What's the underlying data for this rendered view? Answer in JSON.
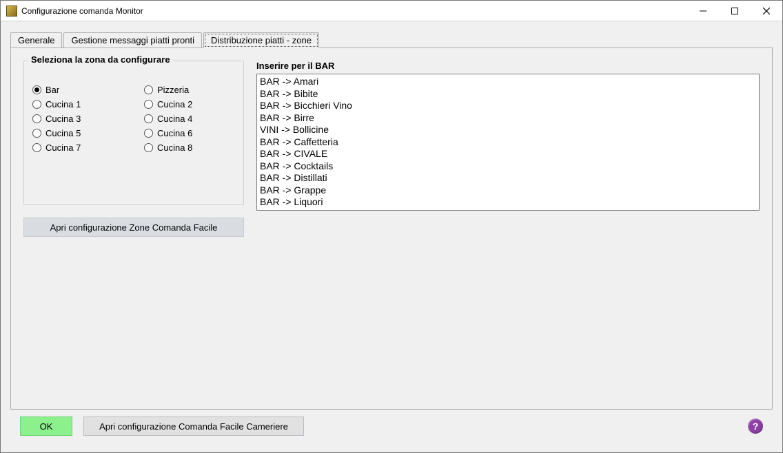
{
  "window": {
    "title": "Configurazione comanda Monitor"
  },
  "tabs": {
    "generale": "Generale",
    "messaggi": "Gestione messaggi piatti pronti",
    "distribuzione": "Distribuzione piatti - zone",
    "active": "distribuzione"
  },
  "zone": {
    "legend": "Seleziona la zona da configurare",
    "selected": "bar",
    "items": {
      "bar": "Bar",
      "pizzeria": "Pizzeria",
      "cucina1": "Cucina 1",
      "cucina2": "Cucina 2",
      "cucina3": "Cucina 3",
      "cucina4": "Cucina 4",
      "cucina5": "Cucina 5",
      "cucina6": "Cucina 6",
      "cucina7": "Cucina 7",
      "cucina8": "Cucina 8"
    }
  },
  "listbox": {
    "label": "Inserire per il BAR",
    "items": [
      "BAR -> Amari",
      "BAR -> Bibite",
      "BAR -> Bicchieri Vino",
      "BAR -> Birre",
      "VINI -> Bollicine",
      "BAR -> Caffetteria",
      "BAR -> CIVALE",
      "BAR -> Cocktails",
      "BAR -> Distillati",
      "BAR -> Grappe",
      "BAR -> Liquori"
    ]
  },
  "buttons": {
    "open_zone_config": "Apri configurazione Zone Comanda Facile",
    "ok": "OK",
    "open_waiter_config": "Apri configurazione Comanda Facile Cameriere"
  },
  "icons": {
    "help": "?"
  }
}
